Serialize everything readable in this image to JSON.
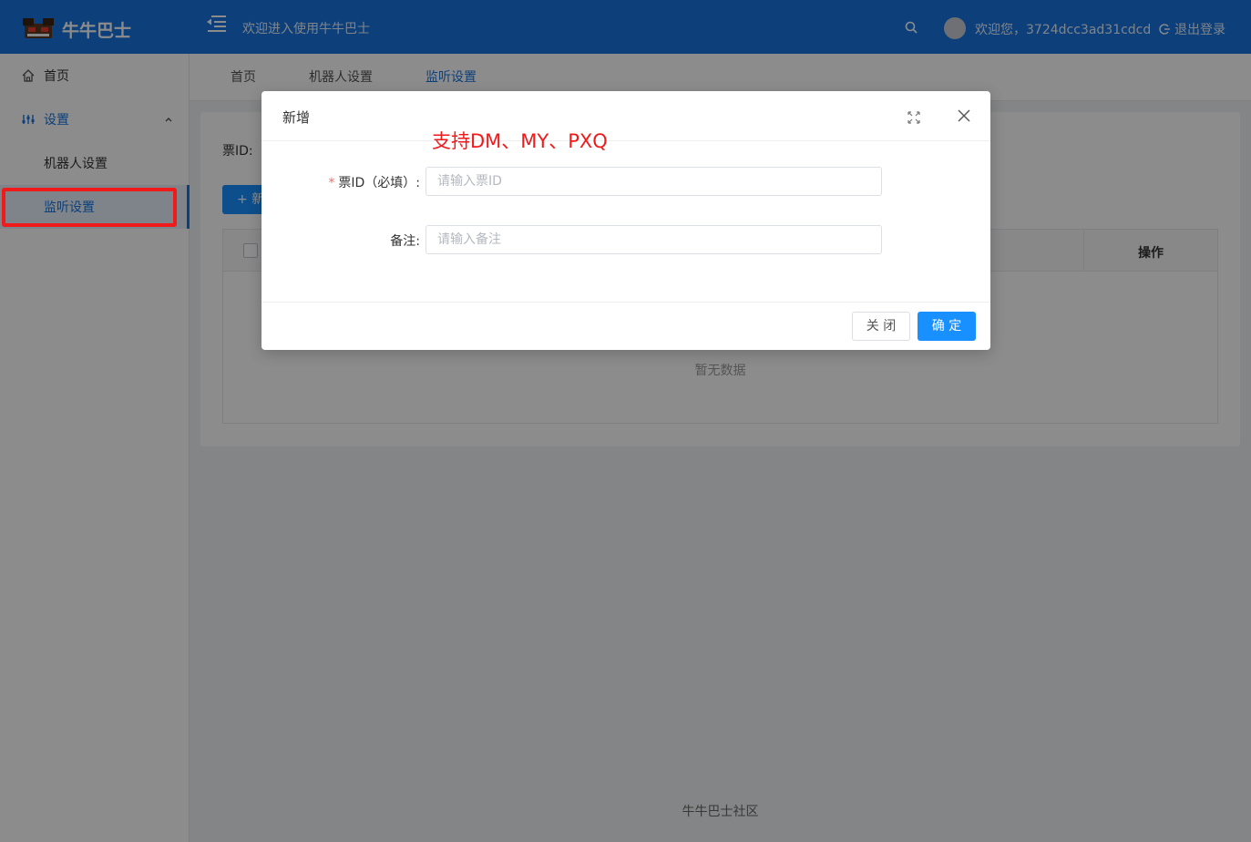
{
  "header": {
    "brand": "牛牛巴士",
    "welcome": "欢迎进入使用牛牛巴士",
    "greeting": "欢迎您，3724dcc3ad31cdcd",
    "logout": "退出登录"
  },
  "sidebar": {
    "items": [
      {
        "label": "首页",
        "icon": "home-icon"
      },
      {
        "label": "设置",
        "icon": "settings-icon"
      },
      {
        "label": "机器人设置"
      },
      {
        "label": "监听设置"
      }
    ]
  },
  "tabs": [
    "首页",
    "机器人设置",
    "监听设置"
  ],
  "content": {
    "filter_label": "票ID:",
    "add_label": "新",
    "table": {
      "ops_header": "操作",
      "empty": "暂无数据"
    }
  },
  "footer": "牛牛巴士社区",
  "dialog": {
    "title": "新增",
    "note": "支持DM、MY、PXQ",
    "fields": {
      "ticket_label": "票ID（必填）:",
      "ticket_required": "*",
      "ticket_placeholder": "请输入票ID",
      "remark_label": "备注:",
      "remark_placeholder": "请输入备注"
    },
    "close_label": "关 闭",
    "ok_label": "确 定"
  },
  "colors": {
    "primary": "#1875e0",
    "button": "#1890ff",
    "annotation": "#f01a1a"
  }
}
